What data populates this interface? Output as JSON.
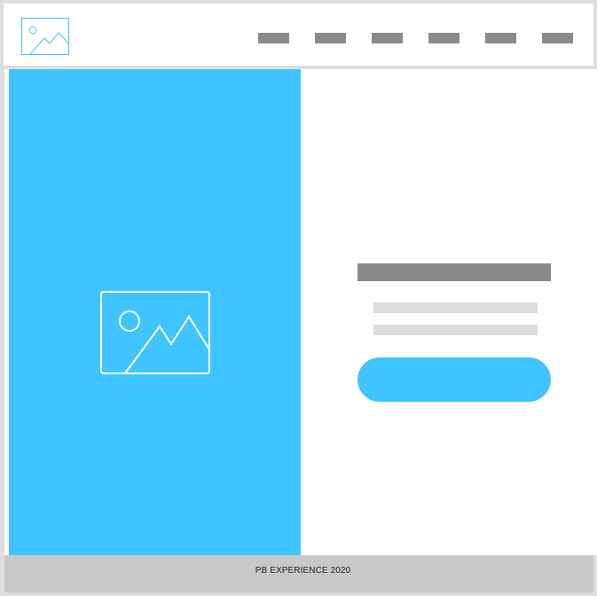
{
  "header": {
    "logo_icon": "image-placeholder-icon",
    "nav_items": [
      "",
      "",
      "",
      "",
      "",
      ""
    ]
  },
  "hero": {
    "image_icon": "image-placeholder-icon"
  },
  "content": {
    "headline": "",
    "lines": [
      "",
      ""
    ],
    "button_label": ""
  },
  "footer": {
    "text": "PB EXPERIENCE 2020"
  },
  "colors": {
    "accent": "#40c4ff",
    "placeholder_dark": "#8a8a8a",
    "placeholder_light": "#dcdcdc",
    "footer_bg": "#c8c8c8",
    "border": "#dedede"
  }
}
